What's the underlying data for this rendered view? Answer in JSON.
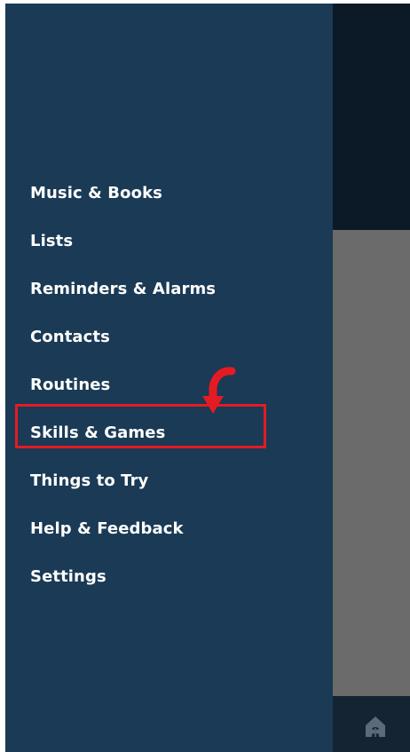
{
  "drawer": {
    "menu_items": [
      {
        "label": "Music & Books"
      },
      {
        "label": "Lists"
      },
      {
        "label": "Reminders & Alarms"
      },
      {
        "label": "Contacts"
      },
      {
        "label": "Routines"
      },
      {
        "label": "Skills & Games"
      },
      {
        "label": "Things to Try"
      },
      {
        "label": "Help & Feedback"
      },
      {
        "label": "Settings"
      }
    ]
  },
  "annotation": {
    "highlighted_item": "Skills & Games",
    "highlight_color": "#e41b23"
  },
  "bottom_bar": {
    "icon": "home-device-icon"
  },
  "colors": {
    "drawer_background": "#1a3a55",
    "menu_text": "#ffffff",
    "backdrop_top": "#0c1a27",
    "backdrop_dim": "#6b6b6b"
  }
}
